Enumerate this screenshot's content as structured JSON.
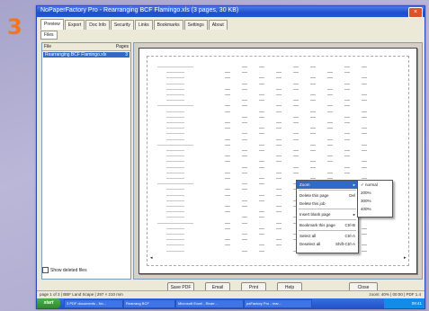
{
  "step_number": "3",
  "window": {
    "title": "NoPaperFactory Pro - Rearranging BCF Flamingo.xls (3 pages, 30 KB)",
    "close_glyph": "×"
  },
  "tabs": [
    "Preview",
    "Export",
    "Doc Info",
    "Security",
    "Links",
    "Bookmarks",
    "Settings",
    "About"
  ],
  "subtab": "Files",
  "file_list": {
    "headers": {
      "name": "File",
      "pages": "Pages"
    },
    "rows": [
      {
        "name": "Rearranging BCF Flamingo.xls",
        "pages": "3"
      }
    ]
  },
  "show_deleted_label": "Show deleted files",
  "context_menu": {
    "items": [
      {
        "label": "Zoom",
        "shortcut": "▸",
        "highlighted": true
      },
      {
        "sep": true
      },
      {
        "label": "Delete this page",
        "shortcut": "Del"
      },
      {
        "label": "Delete this job",
        "shortcut": ""
      },
      {
        "sep": true
      },
      {
        "label": "Insert blank page",
        "shortcut": "▸"
      },
      {
        "sep": true
      },
      {
        "label": "Bookmark this page",
        "shortcut": "Ctrl-B"
      },
      {
        "sep": true
      },
      {
        "label": "Select all",
        "shortcut": "Ctrl-A"
      },
      {
        "label": "Deselect all",
        "shortcut": "Shift-Ctrl-A"
      }
    ]
  },
  "zoom_submenu": [
    "✓ normal",
    "200%",
    "300%",
    "400%"
  ],
  "buttons": [
    "Save PDF",
    "Email",
    "Print",
    "Help",
    "Close"
  ],
  "statusbar": {
    "left": "page 1 of 3  |  BBF Land Scape  |  297 × 210 mm",
    "right": "zoom: 40%  |  00:00  |  PDF 1.4"
  },
  "taskbar": {
    "start_label": "start",
    "items": [
      "3 PDF documents - No...",
      "Rearrang BCF",
      "Microsoft Excel - Rearr...",
      "paFactory Pro - rear..."
    ],
    "clock": "09:41"
  }
}
